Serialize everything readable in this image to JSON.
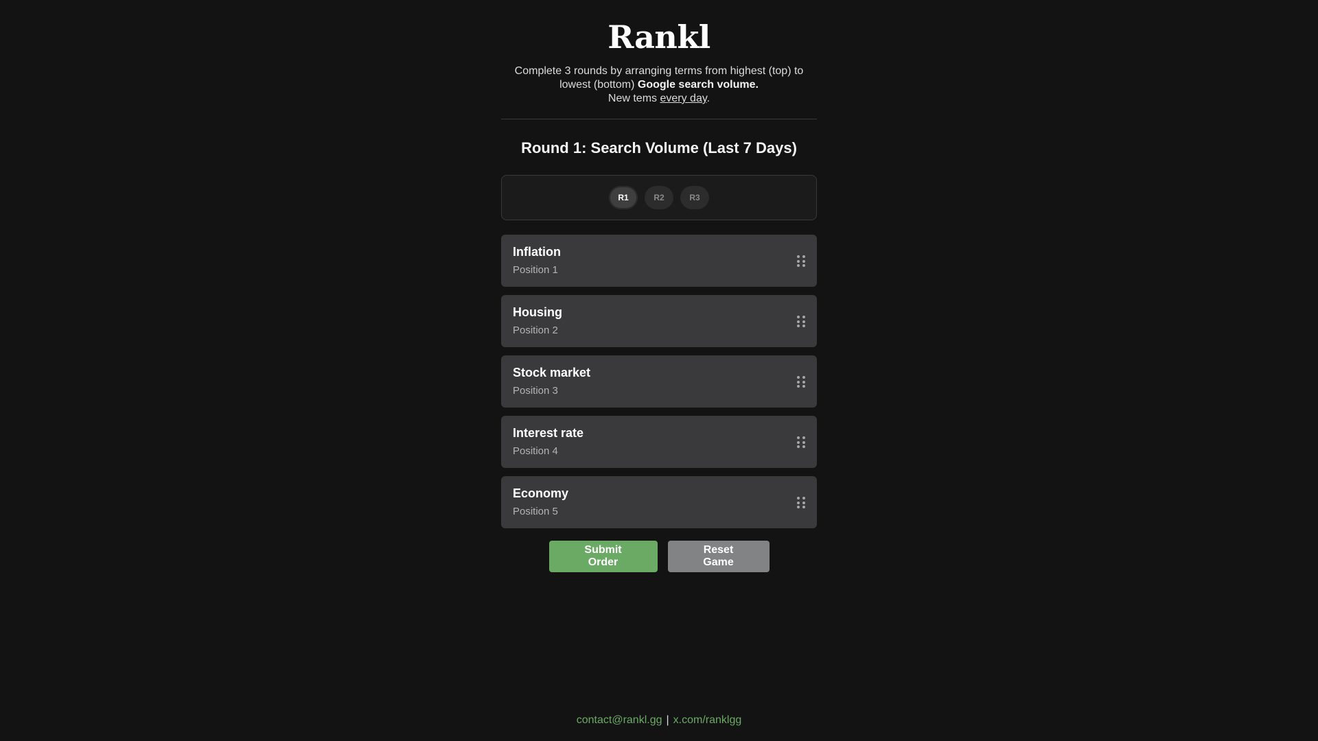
{
  "header": {
    "title": "Rankl",
    "intro_line1": "Complete 3 rounds by arranging terms from highest (top) to",
    "intro_line2_prefix": "lowest (bottom) ",
    "intro_line2_bold": "Google search volume.",
    "intro_line3_prefix": "New tems ",
    "intro_line3_underline": "every day",
    "intro_line3_suffix": "."
  },
  "round": {
    "title": "Round 1: Search Volume (Last 7 Days)",
    "pills": [
      {
        "label": "R1",
        "active": true
      },
      {
        "label": "R2",
        "active": false
      },
      {
        "label": "R3",
        "active": false
      }
    ]
  },
  "items": [
    {
      "label": "Inflation",
      "position": "Position 1"
    },
    {
      "label": "Housing",
      "position": "Position 2"
    },
    {
      "label": "Stock market",
      "position": "Position 3"
    },
    {
      "label": "Interest rate",
      "position": "Position 4"
    },
    {
      "label": "Economy",
      "position": "Position 5"
    }
  ],
  "actions": {
    "submit_label": "Submit Order",
    "reset_label": "Reset Game"
  },
  "footer": {
    "email": "contact@rankl.gg",
    "separator": "|",
    "twitter": "x.com/ranklgg"
  },
  "colors": {
    "background": "#131313",
    "item_bg": "#3a3a3c",
    "submit": "#6aaa64",
    "reset": "#818384",
    "link": "#6aaa64"
  },
  "icons": {
    "drag_handle": "drag-handle-icon"
  }
}
